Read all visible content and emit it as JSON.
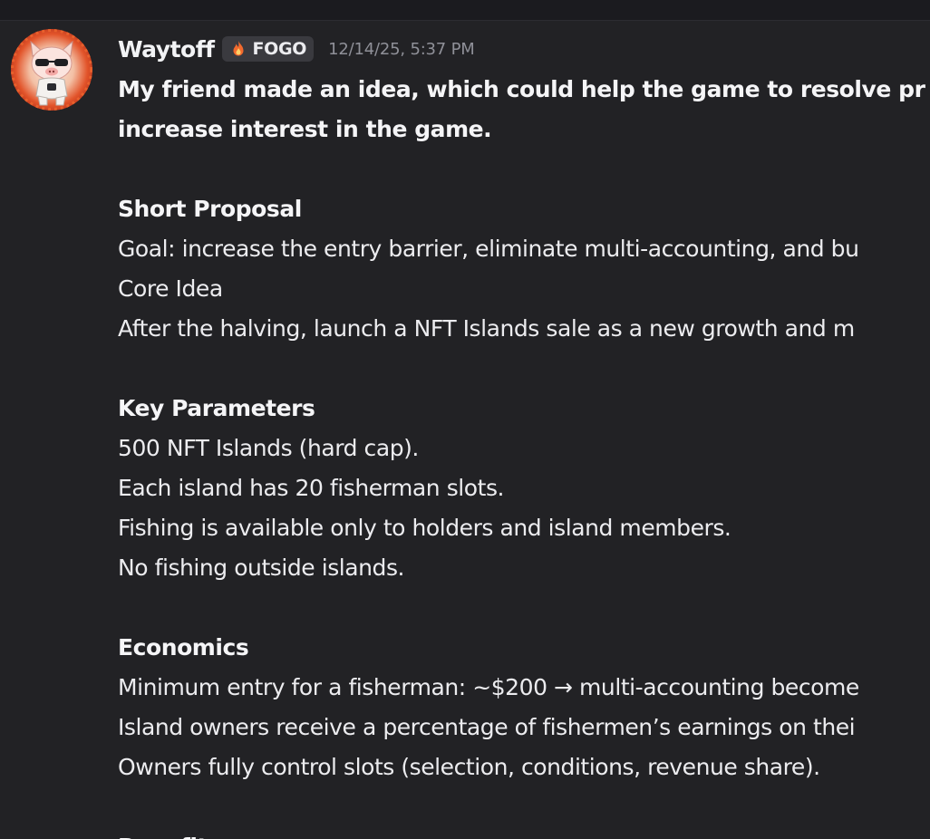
{
  "message": {
    "author": "Waytoff",
    "tag": {
      "icon": "fire-icon",
      "label": "FOGO"
    },
    "timestamp": "12/14/25, 5:37 PM",
    "lines": [
      {
        "text": "My friend made an idea, which could help the game to resolve pr",
        "bold": true
      },
      {
        "text": "increase interest in the game.",
        "bold": true
      },
      {
        "text": "",
        "bold": false
      },
      {
        "text": "Short Proposal",
        "bold": true
      },
      {
        "text": "Goal: increase the entry barrier, eliminate multi-accounting, and bu",
        "bold": false
      },
      {
        "text": "Core Idea",
        "bold": false
      },
      {
        "text": "After the halving, launch a NFT Islands sale as a new growth and m",
        "bold": false
      },
      {
        "text": "",
        "bold": false
      },
      {
        "text": "Key Parameters",
        "bold": true
      },
      {
        "text": "500 NFT Islands (hard cap).",
        "bold": false
      },
      {
        "text": "Each island has 20 fisherman slots.",
        "bold": false
      },
      {
        "text": "Fishing is available only to holders and island members.",
        "bold": false
      },
      {
        "text": "No fishing outside islands.",
        "bold": false
      },
      {
        "text": "",
        "bold": false
      },
      {
        "text": "Economics",
        "bold": true
      },
      {
        "text": "Minimum entry for a fisherman: ~$200 → multi-accounting become",
        "bold": false
      },
      {
        "text": "Island owners receive a percentage of fishermen’s earnings on thei",
        "bold": false
      },
      {
        "text": "Owners fully control slots (selection, conditions, revenue share).",
        "bold": false
      },
      {
        "text": "",
        "bold": false
      },
      {
        "text": "Benefits",
        "bold": true
      }
    ]
  },
  "colors": {
    "background": "#222225",
    "text": "#ececef",
    "timestamp": "#8f9098",
    "tag_background": "#3a3a3f"
  }
}
